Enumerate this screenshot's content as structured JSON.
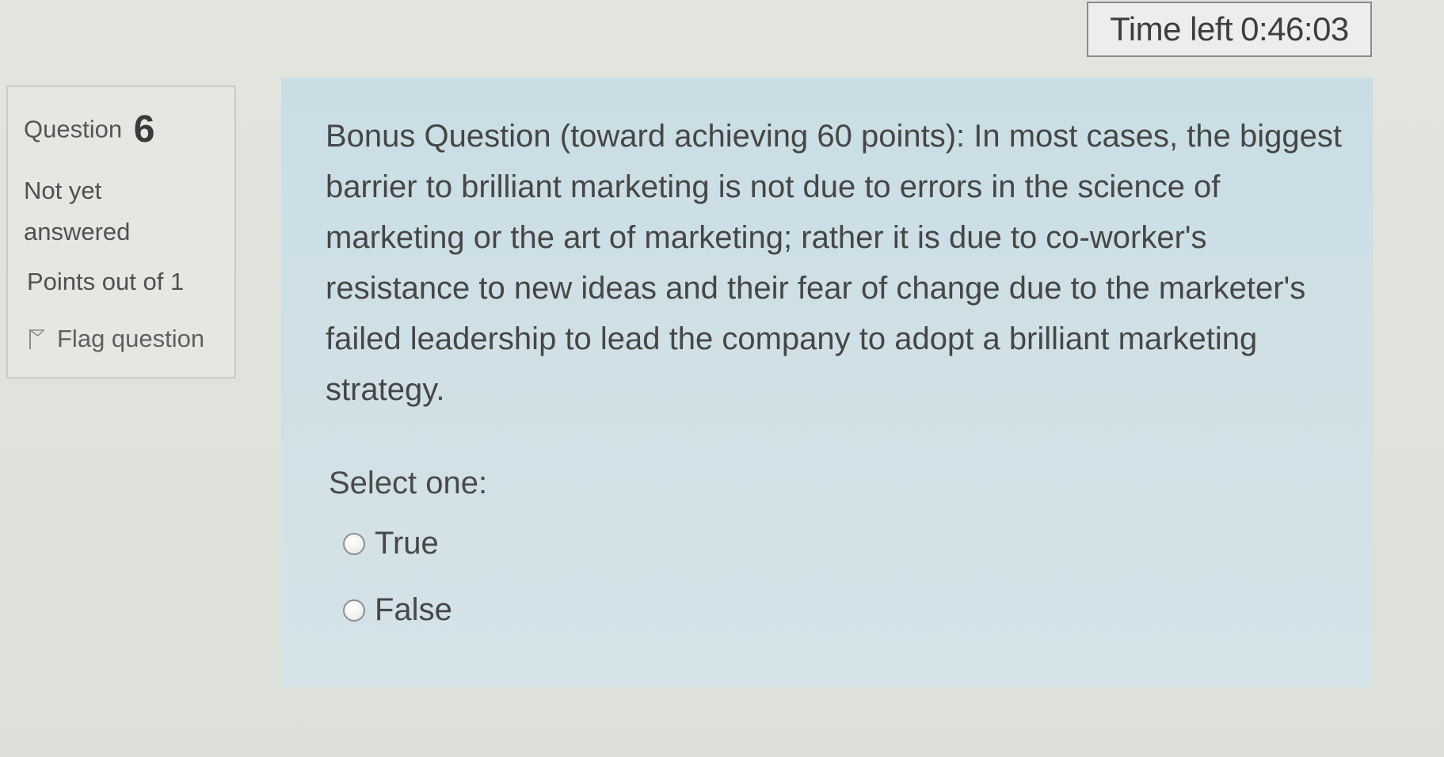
{
  "timer": {
    "label": "Time left",
    "value": "0:46:03"
  },
  "question_info": {
    "label": "Question",
    "number": "6",
    "state": "Not yet answered",
    "grade": "Points out of 1",
    "flag_label": "Flag question",
    "flag_icon": "flag-icon"
  },
  "question": {
    "text": "Bonus Question (toward achieving 60 points): In most cases, the biggest barrier to brilliant marketing is not due to errors in the science of marketing or the art of marketing; rather it is due to co-worker's resistance to new ideas and their fear of change due to the marketer's failed leadership to lead the company to adopt a brilliant marketing strategy.",
    "prompt": "Select one:",
    "options": [
      {
        "label": "True",
        "selected": false
      },
      {
        "label": "False",
        "selected": false
      }
    ]
  }
}
